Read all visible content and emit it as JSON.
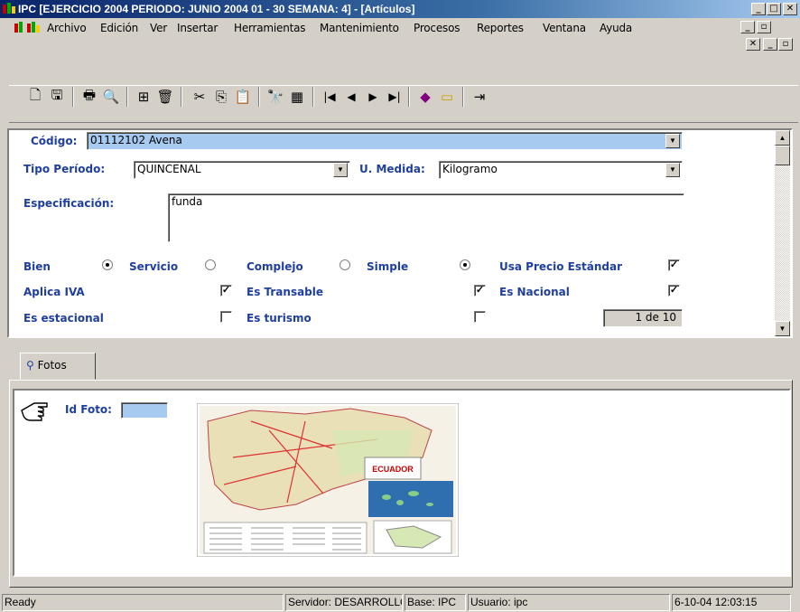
{
  "window": {
    "title": "IPC [EJERCICIO 2004 PERIODO: JUNIO 2004 01 - 30 SEMANA: 4] - [Artículos]"
  },
  "menu": [
    "Archivo",
    "Edición",
    "Ver",
    "Insertar",
    "Herramientas",
    "Mantenimiento",
    "Procesos",
    "Reportes",
    "Ventana",
    "Ayuda"
  ],
  "toolbar_icons": [
    "new-icon",
    "save-icon",
    "print-icon",
    "print-preview-icon",
    "insert-icon",
    "delete-icon",
    "cut-icon",
    "copy-icon",
    "paste-icon",
    "find-icon",
    "filter-icon",
    "first-icon",
    "prev-icon",
    "next-icon",
    "last-icon",
    "book-icon",
    "folder-icon",
    "exit-icon"
  ],
  "form": {
    "codigo_label": "Código:",
    "codigo_value": "01112102 Avena",
    "tipo_periodo_label": "Tipo Período:",
    "tipo_periodo_value": "QUINCENAL",
    "unidad_label": "U. Medida:",
    "unidad_value": "Kilogramo",
    "especificacion_label": "Especificación:",
    "especificacion_value": "funda",
    "bien_label": "Bien",
    "servicio_label": "Servicio",
    "complejo_label": "Complejo",
    "simple_label": "Simple",
    "usa_precio_label": "Usa Precio Estándar",
    "aplica_iva_label": "Aplica IVA",
    "es_transable_label": "Es Transable",
    "es_nacional_label": "Es Nacional",
    "es_estacional_label": "Es estacional",
    "es_turismo_label": "Es turismo",
    "record_counter": "1 de 10",
    "checks": {
      "usa_precio": true,
      "aplica_iva": true,
      "es_transable": true,
      "es_nacional": true,
      "es_estacional": false,
      "es_turismo": false
    },
    "radios": {
      "bien": true,
      "servicio": false,
      "complejo": false,
      "simple": true
    }
  },
  "tabs": {
    "fotos_label": "Fotos"
  },
  "photo": {
    "id_label": "Id Foto:",
    "map_title": "ECUADOR"
  },
  "status": {
    "ready": "Ready",
    "servidor": "Servidor: DESARROLLO",
    "base": "Base: IPC",
    "usuario": "Usuario: ipc",
    "datetime": "6-10-04 12:03:15"
  },
  "colors": {
    "title_start": "#0a246a",
    "label_blue": "#1f3f9f",
    "selected_field": "#a6caf0"
  }
}
